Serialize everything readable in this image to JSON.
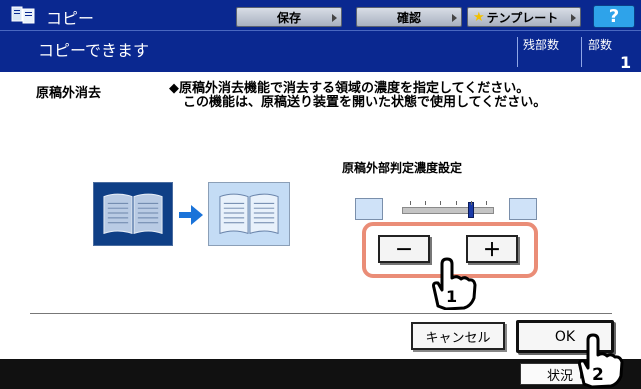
{
  "header": {
    "app_title": "コピー",
    "buttons": {
      "save": "保存",
      "confirm": "確認",
      "template": "テンプレート",
      "help": "?"
    }
  },
  "status": {
    "message": "コピーできます",
    "remaining_label": "残部数",
    "copies_label": "部数",
    "copies_value": "1"
  },
  "function": {
    "title": "原稿外消去",
    "description": [
      "◆原稿外消去機能で消去する領域の濃度を指定してください。",
      "この機能は、原稿送り装置を開いた状態で使用してください。"
    ]
  },
  "density": {
    "title": "原稿外部判定濃度設定",
    "level_fraction": 0.75,
    "minus_label": "－",
    "plus_label": "＋"
  },
  "actions": {
    "cancel_label": "キャンセル",
    "ok_label": "OK"
  },
  "footer": {
    "status_label": "状況"
  },
  "callouts": [
    "1",
    "2"
  ],
  "colors": {
    "header_bg": "#0a2890",
    "highlight": "#ea8d77",
    "help_button": "#2ea3ea",
    "slider_thumb": "#1a3aa8"
  }
}
